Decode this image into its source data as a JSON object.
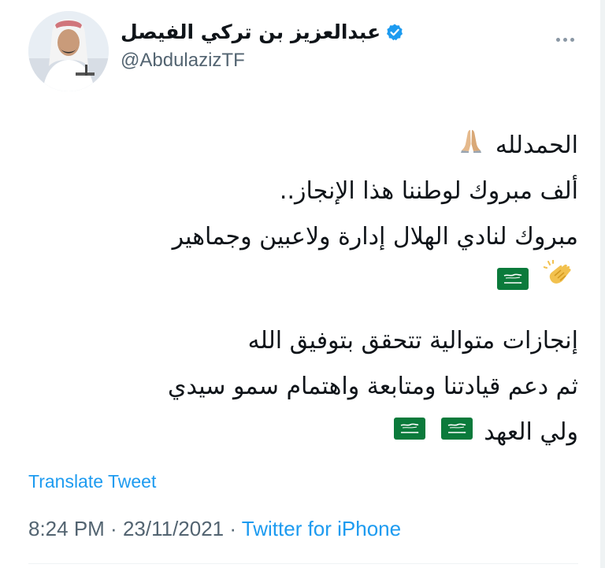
{
  "tweet": {
    "display_name": "عبدالعزيز بن تركي الفيصل",
    "handle": "@AbdulazizTF",
    "lines": {
      "l1": "الحمدلله",
      "l2": "ألف مبروك لوطننا هذا الإنجاز..",
      "l3": "مبروك لنادي الهلال إدارة ولاعبين وجماهير",
      "l5": "إنجازات متوالية تتحقق بتوفيق الله",
      "l6": "ثم دعم قيادتنا ومتابعة واهتمام سمو سيدي",
      "l7": "ولي العهد"
    },
    "translate_label": "Translate Tweet",
    "time": "8:24 PM",
    "separator": " · ",
    "date": "23/11/2021",
    "source": "Twitter for iPhone"
  },
  "icons": {
    "verified": "verified-badge-icon",
    "more": "more-dots-icon",
    "pray": "folded-hands-emoji",
    "clap": "clapping-hands-emoji",
    "flag": "saudi-flag-emoji"
  },
  "colors": {
    "link": "#1d9bf0",
    "secondary": "#536471",
    "text": "#0f1419",
    "flag_green": "#0b7a3b"
  }
}
